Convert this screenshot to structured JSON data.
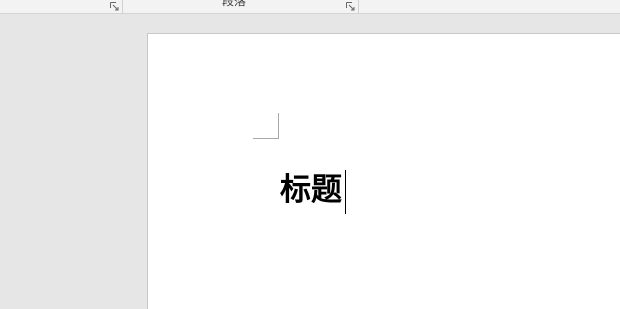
{
  "ribbon": {
    "paragraph_group_label": "段落",
    "icons": [
      "dialog-launcher-icon",
      "dialog-launcher-icon"
    ]
  },
  "document": {
    "heading": "标题"
  },
  "colors": {
    "canvas": "#e6e6e6",
    "page": "#ffffff",
    "text": "#000000"
  }
}
